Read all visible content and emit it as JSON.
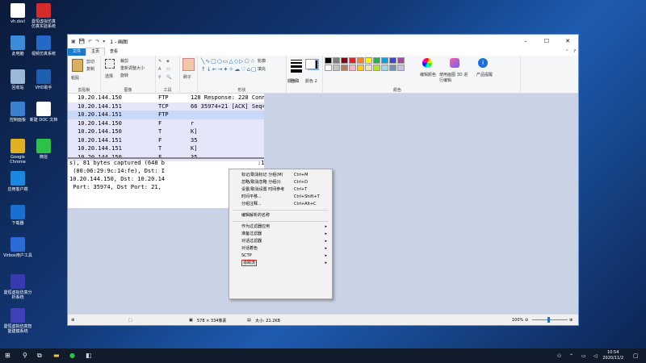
{
  "desktop": {
    "icons": [
      {
        "label": "vh.dsvl",
        "color": "#ffffff"
      },
      {
        "label": "曼恒虚拟仿真 仿真实验系统",
        "color": "#d82a2a"
      },
      {
        "label": "此电脑",
        "color": "#3b8bd9"
      },
      {
        "label": "视频仿真系统",
        "color": "#2468c8"
      },
      {
        "label": "回收站",
        "color": "#9cb8d8"
      },
      {
        "label": "VHD助手",
        "color": "#1f5fb0"
      },
      {
        "label": "控制面板",
        "color": "#3b7fd0"
      },
      {
        "label": "新建 DOC 文档",
        "color": "#ffffff"
      },
      {
        "label": "Google Chrome",
        "color": "#e0b020"
      },
      {
        "label": "微信",
        "color": "#2cc248"
      },
      {
        "label": "应用客户端",
        "color": "#1a88e0"
      },
      {
        "label": "下载器",
        "color": "#1a70d0"
      },
      {
        "label": "Virbox用户工具",
        "color": "#2c6ad8"
      },
      {
        "label": "曼恒虚拟仿真分析系统",
        "color": "#3a3ab0"
      },
      {
        "label": "曼恒虚拟仿真智能建模系统",
        "color": "#4040b8"
      }
    ]
  },
  "paint": {
    "title": "1 - 画图",
    "tabs": [
      "文件",
      "主页",
      "查看"
    ],
    "groups": {
      "clipboard": "剪贴板",
      "image": "图像",
      "tools": "工具",
      "shapes": "形状",
      "colors": "颜色"
    },
    "clipboard_items": [
      "粘贴",
      "剪切",
      "复制"
    ],
    "image_items": [
      "选择",
      "裁剪",
      "重新调整大小",
      "旋转"
    ],
    "brush": "刷子",
    "shapes_items": [
      "轮廓",
      "填充"
    ],
    "size_label": "粗细",
    "color1": "颜色 1",
    "color2": "颜色 2",
    "edit_colors": "编辑颜色",
    "paint3d": "使用画图 3D 进行编辑",
    "product_alert": "产品提醒",
    "palette": [
      "#000000",
      "#7f7f7f",
      "#880015",
      "#ed1c24",
      "#ff7f27",
      "#fff200",
      "#22b14c",
      "#00a2e8",
      "#3f48cc",
      "#a349a4",
      "#ffffff",
      "#c3c3c3",
      "#b97a57",
      "#ffaec9",
      "#ffc90e",
      "#efe4b0",
      "#b5e61d",
      "#99d9ea",
      "#7092be",
      "#c8bfe7"
    ]
  },
  "packets": [
    {
      "ip": "10.20.144.150",
      "proto": "FTP",
      "info": "128 Response: 220 Connec"
    },
    {
      "ip": "10.20.144.151",
      "proto": "TCP",
      "info": "66 35974+21 [ACK] Seq=1"
    },
    {
      "ip": "10.20.144.151",
      "proto": "FTP",
      "info": ""
    },
    {
      "ip": "10.20.144.150",
      "proto": "F",
      "info": "r"
    },
    {
      "ip": "10.20.144.150",
      "proto": "T",
      "info": "K]"
    },
    {
      "ip": "10.20.144.151",
      "proto": "F",
      "info": "35"
    },
    {
      "ip": "10.20.144.151",
      "proto": "T",
      "info": "K]"
    },
    {
      "ip": "10.20.144.150",
      "proto": "F",
      "info": "35"
    }
  ],
  "detail_lines": [
    "s), 81 bytes captured (648 b",
    " (00:06:29:9c:14:fe), Dst: I",
    "10.20.144.150, Dst: 10.20.14",
    " Port: 35974, Dst Port: 21,"
  ],
  "detail_tail": [
    ":1",
    "",
    "",
    ""
  ],
  "context_menu": [
    {
      "label": "标记/取消标记 分组(M)",
      "shortcut": "Ctrl+M",
      "arrow": false
    },
    {
      "label": "忽略/取消忽略 分组(I)",
      "shortcut": "Ctrl+D",
      "arrow": false
    },
    {
      "label": "设置/取消设置 时间参考",
      "shortcut": "Ctrl+T",
      "arrow": false
    },
    {
      "label": "时间平移...",
      "shortcut": "Ctrl+Shift+T",
      "arrow": false
    },
    {
      "label": "分组注释...",
      "shortcut": "Ctrl+Alt+C",
      "arrow": false
    },
    {
      "sep": true
    },
    {
      "label": "编辑解析的名称",
      "shortcut": "",
      "arrow": false
    },
    {
      "sep": true
    },
    {
      "label": "作为过滤器应用",
      "shortcut": "",
      "arrow": true
    },
    {
      "label": "准备过滤器",
      "shortcut": "",
      "arrow": true
    },
    {
      "label": "对话过滤器",
      "shortcut": "",
      "arrow": true
    },
    {
      "label": "对话着色",
      "shortcut": "",
      "arrow": true
    },
    {
      "label": "SCTP",
      "shortcut": "",
      "arrow": true
    },
    {
      "label": "追踪流",
      "shortcut": "",
      "arrow": true,
      "highlight": true
    }
  ],
  "status": {
    "dimensions": "578 × 334像素",
    "size": "大小: 21.2KB",
    "zoom": "100%"
  },
  "taskbar": {
    "time": "10:54",
    "date": "2020/11/2"
  }
}
